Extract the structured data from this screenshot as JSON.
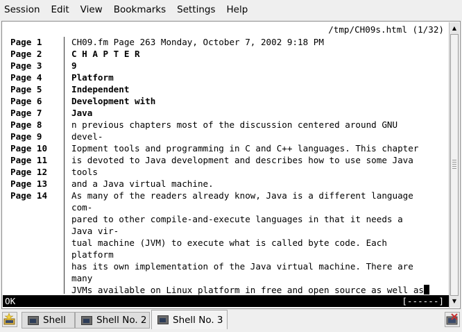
{
  "menubar": {
    "items": [
      "Session",
      "Edit",
      "View",
      "Bookmarks",
      "Settings",
      "Help"
    ]
  },
  "terminal": {
    "header": "/tmp/CH09s.html (1/32)",
    "gutter": [
      "Page 1",
      "Page 2",
      "Page 3",
      "Page 4",
      "Page 5",
      "Page 6",
      "Page 7",
      "Page 8",
      "Page 9",
      "Page 10",
      "Page 11",
      "Page 12",
      "Page 13",
      "Page 14"
    ],
    "lines": [
      "CH09.fm Page 263 Monday, October 7, 2002 9:18 PM",
      "C H A P T E R",
      "9",
      "Platform",
      "Independent",
      "Development with",
      "Java",
      "n previous chapters most of the discussion centered around GNU",
      "devel-",
      "Iopment tools and programming in C and C++ languages. This chapter",
      "is devoted to Java development and describes how to use some Java",
      "tools",
      "and a Java virtual machine.",
      "As many of the readers already know, Java is a different language",
      "com-",
      "pared to other compile-and-execute languages in that it needs a",
      "Java vir-",
      "tual machine (JVM) to execute what is called byte code. Each",
      "platform",
      "has its own implementation of the Java virtual machine. There are",
      "many",
      "JVMs available on Linux platform in free and open source as well as"
    ],
    "status_left": "OK",
    "status_right": "[------]"
  },
  "tabs": [
    {
      "label": "Shell",
      "active": false
    },
    {
      "label": "Shell No. 2",
      "active": false
    },
    {
      "label": "Shell No. 3",
      "active": true
    }
  ]
}
